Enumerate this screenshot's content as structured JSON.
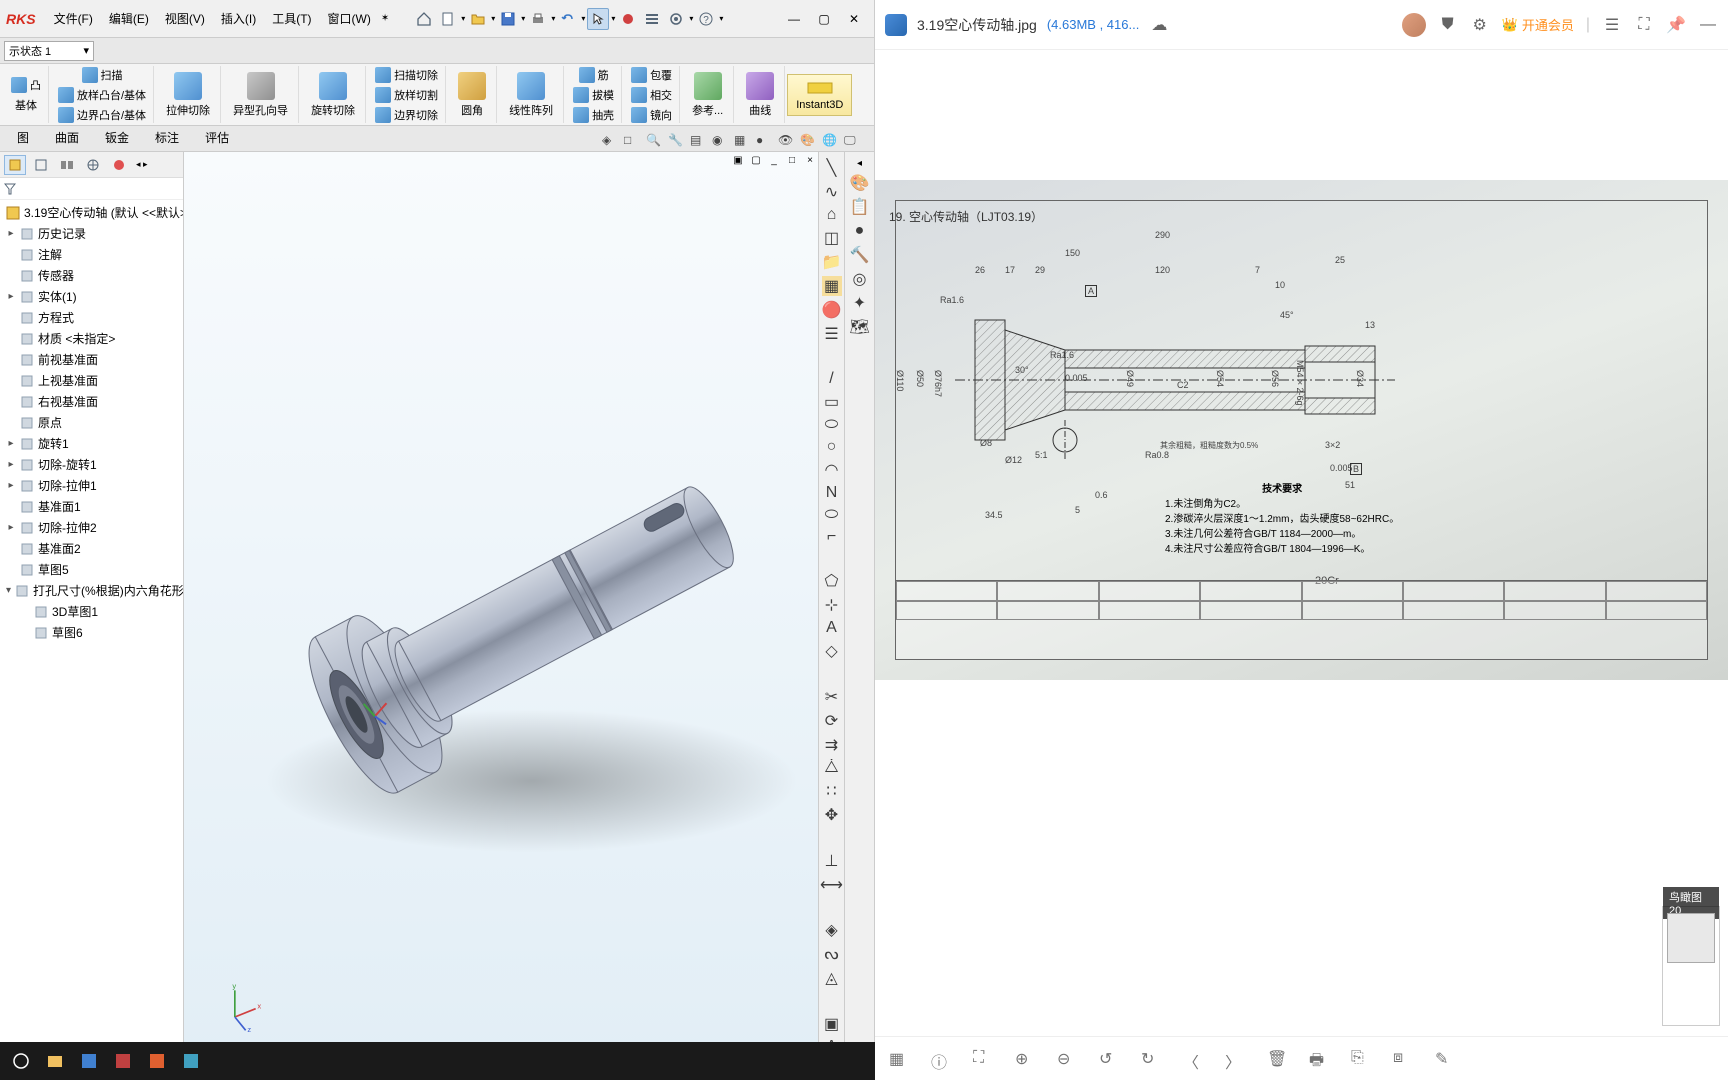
{
  "sw": {
    "logo": "RKS",
    "menus": [
      "文件(F)",
      "编辑(E)",
      "视图(V)",
      "插入(I)",
      "工具(T)",
      "窗口(W)"
    ],
    "state_value": "示状态 1",
    "ribbon": {
      "col1": [
        "凸",
        "基体"
      ],
      "col1b": {
        "scan": "扫描",
        "boss": "放样凸台/基体",
        "boundary": "边界凸台/基体"
      },
      "hole": "异型孔向导",
      "col3": {
        "extrude_cut": "拉伸切除",
        "revolve_cut": "旋转切除"
      },
      "col4": {
        "swept_cut": "扫描切除",
        "loft_cut": "放样切割",
        "boundary_cut": "边界切除"
      },
      "col5": {
        "fillet": "圆角",
        "pattern": "线性阵列"
      },
      "col6": {
        "rib": "筋",
        "draft": "拔模",
        "shell": "抽壳"
      },
      "col7": {
        "wrap": "包覆",
        "intersect": "相交",
        "mirror": "镜向"
      },
      "ref": "参考...",
      "curve": "曲线",
      "instant": "Instant3D"
    },
    "tabs": [
      "图",
      "曲面",
      "钣金",
      "标注",
      "评估"
    ],
    "tree": {
      "root": "3.19空心传动轴  (默认 <<默认>",
      "items": [
        {
          "label": "历史记录",
          "lvl": 1,
          "tog": "▸"
        },
        {
          "label": "注解",
          "lvl": 1,
          "tog": ""
        },
        {
          "label": "传感器",
          "lvl": 1,
          "tog": ""
        },
        {
          "label": "实体(1)",
          "lvl": 1,
          "tog": "▸"
        },
        {
          "label": "方程式",
          "lvl": 1,
          "tog": ""
        },
        {
          "label": "材质 <未指定>",
          "lvl": 1,
          "tog": ""
        },
        {
          "label": "前视基准面",
          "lvl": 1,
          "tog": ""
        },
        {
          "label": "上视基准面",
          "lvl": 1,
          "tog": ""
        },
        {
          "label": "右视基准面",
          "lvl": 1,
          "tog": ""
        },
        {
          "label": "原点",
          "lvl": 1,
          "tog": ""
        },
        {
          "label": "旋转1",
          "lvl": 1,
          "tog": "▸"
        },
        {
          "label": "切除-旋转1",
          "lvl": 1,
          "tog": "▸"
        },
        {
          "label": "切除-拉伸1",
          "lvl": 1,
          "tog": "▸"
        },
        {
          "label": "基准面1",
          "lvl": 1,
          "tog": ""
        },
        {
          "label": "切除-拉伸2",
          "lvl": 1,
          "tog": "▸"
        },
        {
          "label": "基准面2",
          "lvl": 1,
          "tog": ""
        },
        {
          "label": "草图5",
          "lvl": 1,
          "tog": ""
        },
        {
          "label": "打孔尺寸(%根据)内六角花形",
          "lvl": 1,
          "tog": "▾"
        },
        {
          "label": "3D草图1",
          "lvl": 2,
          "tog": ""
        },
        {
          "label": "草图6",
          "lvl": 2,
          "tog": ""
        }
      ]
    },
    "axes": {
      "x": "x",
      "y": "y",
      "z": "z"
    }
  },
  "viewer": {
    "filename": "3.19空心传动轴.jpg",
    "filesize": "(4.63MB , 416...",
    "vip": "开通会员",
    "thumb_label": "鸟瞰图 20",
    "drawing": {
      "title": "19.  空心传动轴（LJT03.19）",
      "dims": [
        "290",
        "150",
        "120",
        "26",
        "17",
        "29",
        "25",
        "7",
        "10",
        "34.5",
        "5:1",
        "0.6",
        "5",
        "51",
        "13",
        "Ra1.6",
        "Ra1.6",
        "Ra0.8",
        "30°",
        "45°",
        "3×2",
        "Ø50",
        "Ø110",
        "Ø76h7",
        "Ø49",
        "Ø54",
        "Ø56",
        "Ø34",
        "M54×2-6g",
        "Ø8",
        "Ø12",
        "0.005",
        "A",
        "B",
        "0.005",
        "20Cr",
        "C2"
      ],
      "tech_req_label": "技术要求",
      "tech_req": [
        "1.未注倒角为C2。",
        "2.渗碳淬火层深度1～1.2mm，齿头硬度58~62HRC。",
        "3.未注几何公差符合GB/T 1184—2000—m。",
        "4.未注尺寸公差应符合GB/T 1804—1996—K。"
      ],
      "note": "其余粗糙，粗糙度数为0.5%"
    }
  }
}
